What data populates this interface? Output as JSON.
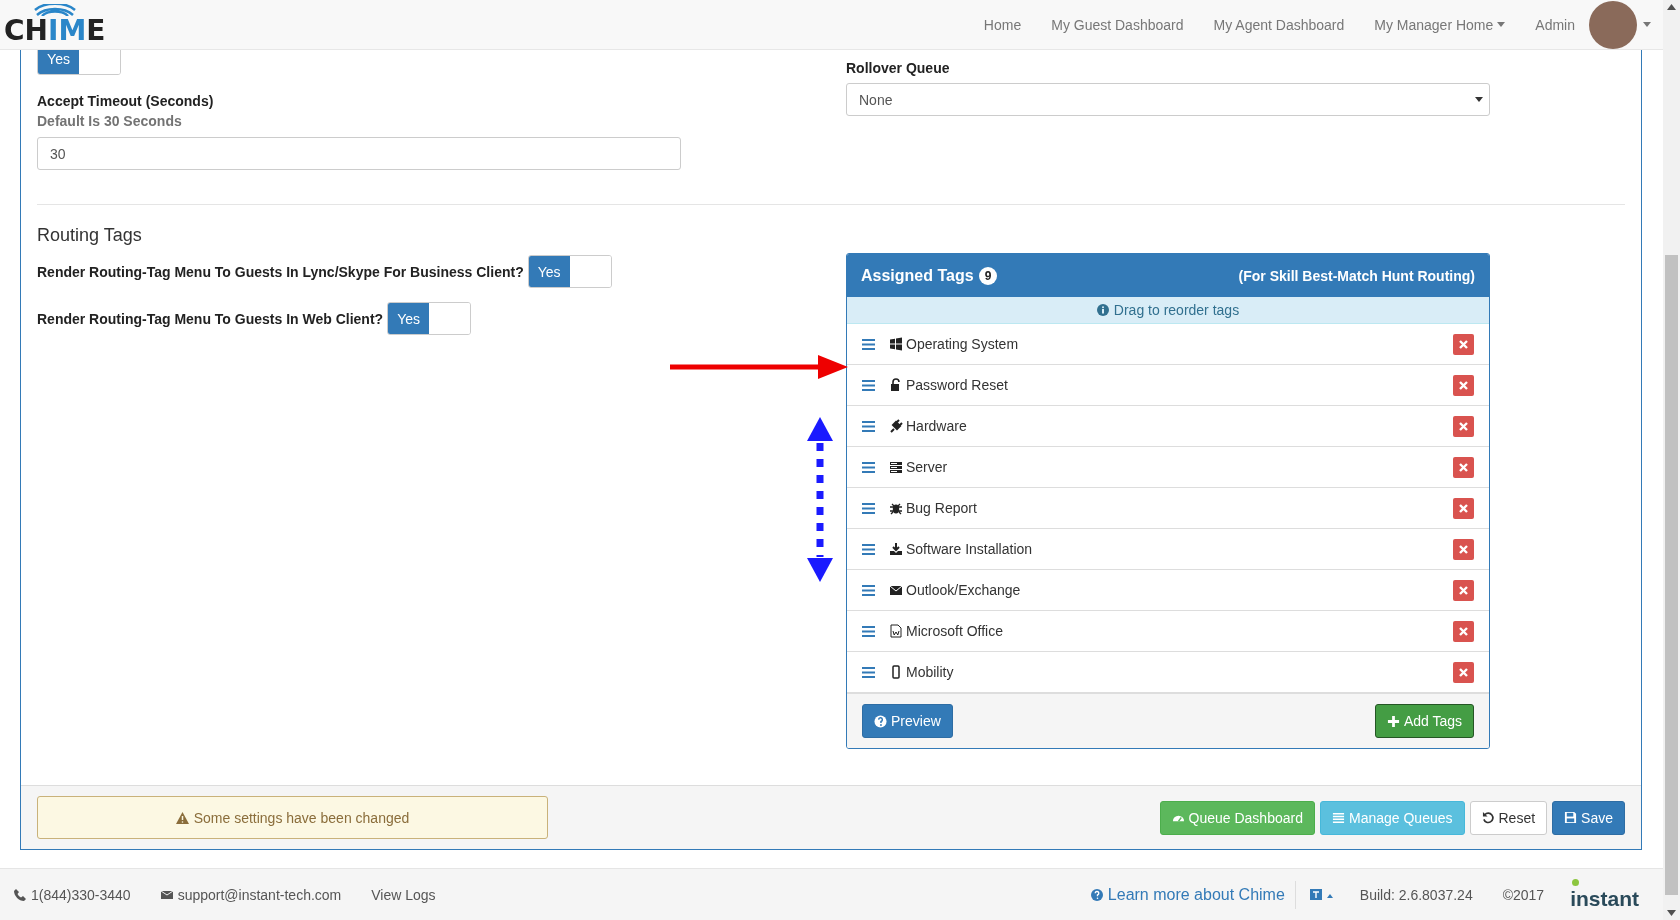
{
  "navbar": {
    "logo": "CHIME",
    "links": [
      {
        "label": "Home",
        "dropdown": false
      },
      {
        "label": "My Guest Dashboard",
        "dropdown": false
      },
      {
        "label": "My Agent Dashboard",
        "dropdown": false
      },
      {
        "label": "My Manager Home",
        "dropdown": true
      },
      {
        "label": "Admin",
        "dropdown": false
      }
    ]
  },
  "settings": {
    "top_toggle": {
      "label": "Yes",
      "on": true
    },
    "accept_timeout": {
      "label": "Accept Timeout (Seconds)",
      "hint": "Default Is 30 Seconds",
      "value": "30"
    },
    "rollover_queue": {
      "label": "Rollover Queue",
      "value": "None"
    }
  },
  "routing_tags": {
    "heading": "Routing Tags",
    "options": [
      {
        "label": "Render Routing-Tag Menu To Guests In Lync/Skype For Business Client?",
        "toggle": "Yes",
        "on": true
      },
      {
        "label": "Render Routing-Tag Menu To Guests In Web Client?",
        "toggle": "Yes",
        "on": true
      }
    ]
  },
  "assigned_tags": {
    "title": "Assigned Tags",
    "count": "9",
    "subtitle": "(For Skill Best-Match Hunt Routing)",
    "info": "Drag to reorder tags",
    "tags": [
      {
        "label": "Operating System"
      },
      {
        "label": "Password Reset"
      },
      {
        "label": "Hardware"
      },
      {
        "label": "Server"
      },
      {
        "label": "Bug Report"
      },
      {
        "label": "Software Installation"
      },
      {
        "label": "Outlook/Exchange"
      },
      {
        "label": "Microsoft Office"
      },
      {
        "label": "Mobility"
      }
    ],
    "preview_button": "Preview",
    "add_button": "Add Tags"
  },
  "action_bar": {
    "warning": "Some settings have been changed",
    "buttons": [
      {
        "label": "Queue Dashboard",
        "kind": "success"
      },
      {
        "label": "Manage Queues",
        "kind": "info"
      },
      {
        "label": "Reset",
        "kind": "default"
      },
      {
        "label": "Save",
        "kind": "primary"
      }
    ]
  },
  "footer": {
    "phone": "1(844)330-3440",
    "email": "support@instant-tech.com",
    "view_logs": "View Logs",
    "learn_more": "Learn more about Chime",
    "build": "Build: 2.6.8037.24",
    "copyright": "©2017",
    "brand": "instant"
  }
}
